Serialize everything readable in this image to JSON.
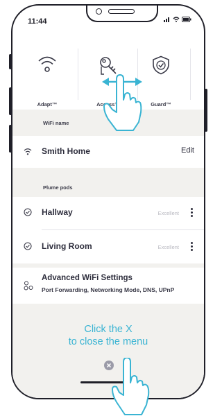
{
  "status": {
    "time": "11:44"
  },
  "tabs": [
    {
      "label": "Adapt™",
      "icon": "wifi-icon"
    },
    {
      "label": "Access™",
      "icon": "keys-icon"
    },
    {
      "label": "Guard™",
      "icon": "shield-check-icon"
    }
  ],
  "wifi": {
    "header": "WiFi name",
    "name": "Smith Home",
    "edit_label": "Edit"
  },
  "pods": {
    "header": "Plume pods",
    "items": [
      {
        "name": "Hallway",
        "quality": "Excellent"
      },
      {
        "name": "Living Room",
        "quality": "Excellent"
      }
    ]
  },
  "advanced": {
    "title": "Advanced WiFi Settings",
    "subtitle": "Port Forwarding, Networking Mode, DNS, UPnP"
  },
  "hint": {
    "line1": "Click the X",
    "line2": "to close the menu"
  },
  "colors": {
    "accent": "#3ab4d3",
    "menu_bg": "#f2f1ee",
    "frame": "#1f1f28"
  }
}
